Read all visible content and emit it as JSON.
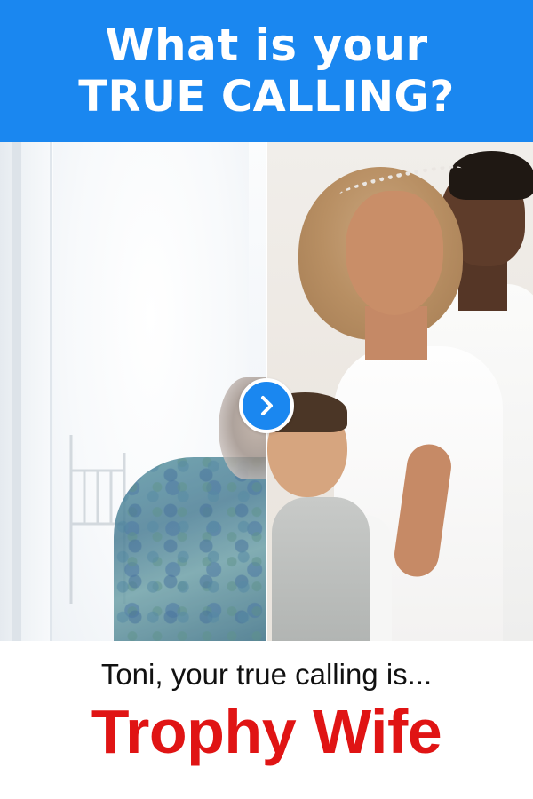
{
  "header": {
    "line1": "What is your",
    "line2": "TRUE CALLING?"
  },
  "photos": {
    "left_image": "faded-photo-of-older-woman",
    "right_image": "family-photo-couple-with-child",
    "reveal_button_icon": "chevron-right-icon"
  },
  "result": {
    "intro": "Toni, your true calling is...",
    "title": "Trophy Wife"
  },
  "colors": {
    "header_bg": "#1a87f0",
    "header_text": "#ffffff",
    "result_title": "#e01414",
    "intro_text": "#111111"
  }
}
